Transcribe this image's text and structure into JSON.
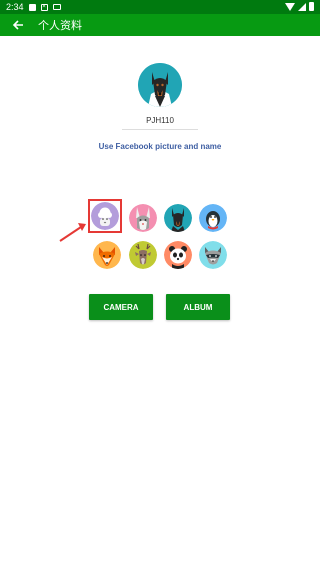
{
  "status_bar": {
    "time": "2:34"
  },
  "app_bar": {
    "title": "个人资料"
  },
  "profile": {
    "username": "PJH110"
  },
  "prompt": "Use Facebook picture and name",
  "avatars": [
    {
      "name": "sheep",
      "bg": "#b39ddb"
    },
    {
      "name": "rabbit",
      "bg": "#f48fb1"
    },
    {
      "name": "doberman",
      "bg": "#21a5b5"
    },
    {
      "name": "penguin",
      "bg": "#64b5f6"
    },
    {
      "name": "fox",
      "bg": "#ffb74d"
    },
    {
      "name": "deer",
      "bg": "#c0ca33"
    },
    {
      "name": "panda",
      "bg": "#ff8a65"
    },
    {
      "name": "raccoon",
      "bg": "#80deea"
    }
  ],
  "buttons": {
    "camera": "CAMERA",
    "album": "ALBUM"
  },
  "colors": {
    "status_bar": "#007a0f",
    "app_bar": "#079a12",
    "button": "#0a8f1a",
    "highlight": "#e53935"
  }
}
